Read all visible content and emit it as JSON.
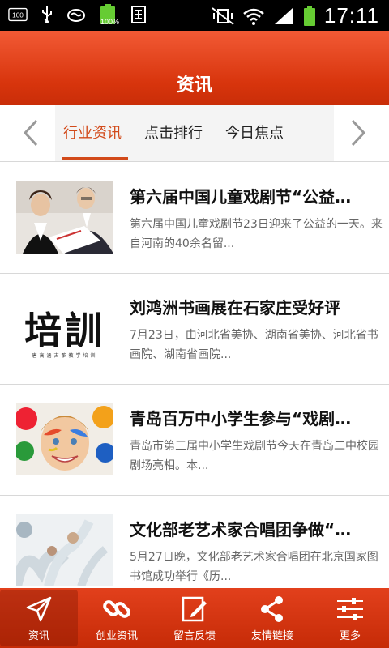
{
  "status_bar": {
    "left_icons": [
      "sim-100-icon",
      "usb-icon",
      "cat-icon",
      "battery-full-icon",
      "keyboard-icon"
    ],
    "battery_percent_label": "100%",
    "sim_label": "100",
    "right_icons": [
      "vibrate-mute-icon",
      "wifi-icon",
      "signal-icon",
      "battery-icon"
    ],
    "time": "17:11"
  },
  "header": {
    "title": "资讯"
  },
  "tabs": {
    "items": [
      {
        "label": "行业资讯",
        "active": true
      },
      {
        "label": "点击排行",
        "active": false
      },
      {
        "label": "今日焦点",
        "active": false
      }
    ]
  },
  "news": [
    {
      "title": "第六届中国儿童戏剧节“公益…",
      "summary": "第六届中国儿童戏剧节23日迎来了公益的一天。来自河南的40余名留...",
      "thumb": "business-people-photo"
    },
    {
      "title": "刘鸿洲书画展在石家庄受好评",
      "summary": "7月23日，由河北省美协、湖南省美协、河北省书画院、湖南省画院...",
      "thumb": "calligraphy-image",
      "thumb_text": "培訓",
      "thumb_caption": "唐高涵古筝教学培训"
    },
    {
      "title": "青岛百万中小学生参与“戏剧…",
      "summary": "  青岛市第三届中小学生戏剧节今天在青岛二中校园剧场亮相。本...",
      "thumb": "painted-child-photo"
    },
    {
      "title": "文化部老艺术家合唱团争做“…",
      "summary": "5月27日晚，文化部老艺术家合唱团在北京国家图书馆成功举行《历...",
      "thumb": "dancers-photo"
    }
  ],
  "bottom_nav": [
    {
      "label": "资讯",
      "icon": "paper-plane-icon",
      "active": true
    },
    {
      "label": "创业资讯",
      "icon": "chain-link-icon",
      "active": false
    },
    {
      "label": "留言反馈",
      "icon": "edit-note-icon",
      "active": false
    },
    {
      "label": "友情链接",
      "icon": "share-icon",
      "active": false
    },
    {
      "label": "更多",
      "icon": "sliders-icon",
      "active": false
    }
  ],
  "colors": {
    "brand": "#d8350d",
    "tab_active": "#d24a1a"
  }
}
